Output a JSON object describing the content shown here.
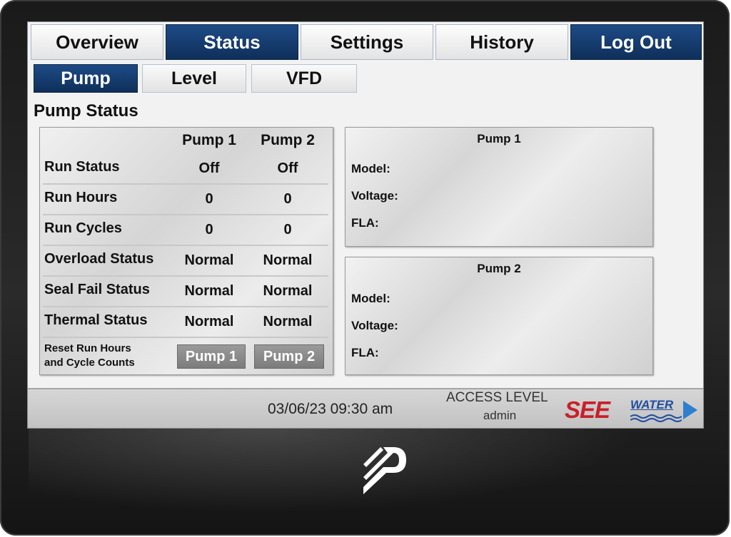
{
  "tabs": [
    {
      "label": "Overview",
      "active": false
    },
    {
      "label": "Status",
      "active": true
    },
    {
      "label": "Settings",
      "active": false
    },
    {
      "label": "History",
      "active": false
    },
    {
      "label": "Log Out",
      "active": true
    }
  ],
  "subtabs": [
    {
      "label": "Pump",
      "active": true
    },
    {
      "label": "Level",
      "active": false
    },
    {
      "label": "VFD",
      "active": false
    }
  ],
  "section_title": "Pump Status",
  "status_table": {
    "columns": [
      "Pump 1",
      "Pump 2"
    ],
    "rows": [
      {
        "label": "Run Status",
        "pump1": "Off",
        "pump2": "Off"
      },
      {
        "label": "Run Hours",
        "pump1": "0",
        "pump2": "0"
      },
      {
        "label": "Run Cycles",
        "pump1": "0",
        "pump2": "0"
      },
      {
        "label": "Overload Status",
        "pump1": "Normal",
        "pump2": "Normal"
      },
      {
        "label": "Seal Fail Status",
        "pump1": "Normal",
        "pump2": "Normal"
      },
      {
        "label": "Thermal Status",
        "pump1": "Normal",
        "pump2": "Normal"
      }
    ],
    "reset_label_line1": "Reset Run Hours",
    "reset_label_line2": "and Cycle Counts",
    "reset_buttons": [
      "Pump 1",
      "Pump 2"
    ]
  },
  "pump_info": [
    {
      "title": "Pump 1",
      "fields": [
        "Model:",
        "Voltage:",
        "FLA:"
      ]
    },
    {
      "title": "Pump 2",
      "fields": [
        "Model:",
        "Voltage:",
        "FLA:"
      ]
    }
  ],
  "statusbar": {
    "datetime": "03/06/23 09:30 am",
    "access_label": "ACCESS LEVEL",
    "access_user": "admin",
    "logo_see": "SEE",
    "logo_water": "WATER"
  },
  "colors": {
    "active_tab": "#0f2f5a",
    "logo_red": "#c8202a",
    "logo_blue": "#1f4ea0"
  }
}
